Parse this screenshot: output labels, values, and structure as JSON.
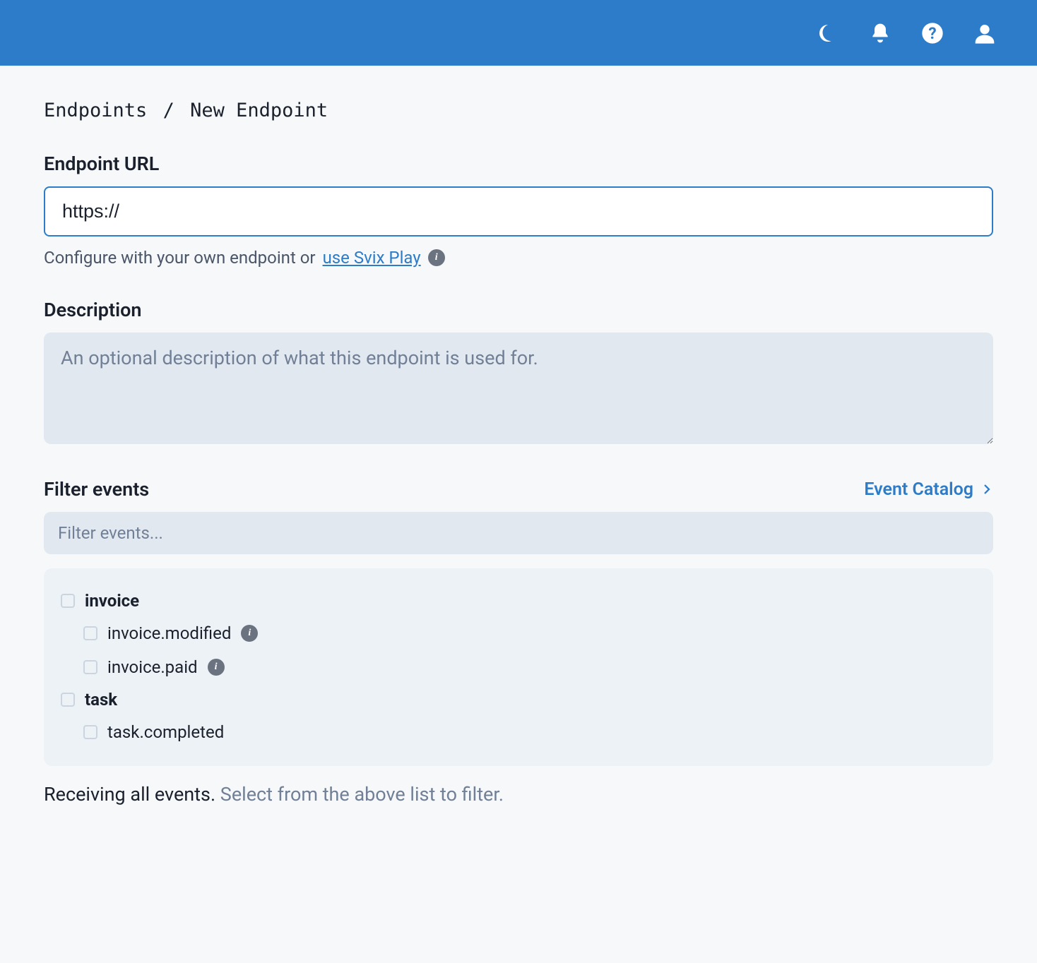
{
  "header": {
    "icons": [
      "moon",
      "bell",
      "help",
      "user"
    ]
  },
  "breadcrumb": {
    "root": "Endpoints",
    "separator": "/",
    "current": "New Endpoint"
  },
  "url": {
    "label": "Endpoint URL",
    "value": "https://",
    "helper_prefix": "Configure with your own endpoint or ",
    "helper_link": "use Svix Play"
  },
  "description": {
    "label": "Description",
    "placeholder": "An optional description of what this endpoint is used for.",
    "value": ""
  },
  "filter": {
    "label": "Filter events",
    "catalog_link": "Event Catalog",
    "search_placeholder": "Filter events...",
    "search_value": "",
    "groups": [
      {
        "name": "invoice",
        "children": [
          {
            "name": "invoice.modified",
            "has_info": true
          },
          {
            "name": "invoice.paid",
            "has_info": true
          }
        ]
      },
      {
        "name": "task",
        "children": [
          {
            "name": "task.completed",
            "has_info": false
          }
        ]
      }
    ]
  },
  "footer": {
    "strong": "Receiving all events.",
    "muted": "Select from the above list to filter."
  },
  "info_glyph": "i"
}
